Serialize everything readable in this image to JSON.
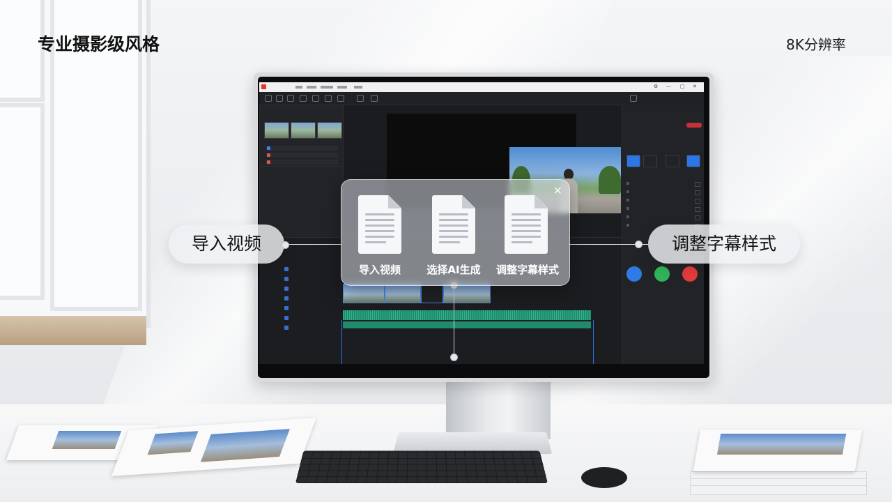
{
  "page": {
    "title": "专业摄影级风格",
    "resolution_badge": "8K分辨率"
  },
  "popup": {
    "items": [
      {
        "label": "导入视频"
      },
      {
        "label": "选择AI生成"
      },
      {
        "label": "调整字幕样式"
      }
    ],
    "close_label": "✕"
  },
  "callouts": {
    "left": "导入视频",
    "right": "调整字幕样式"
  },
  "colors": {
    "accent_blue": "#2d76e6",
    "accent_red": "#c6303a",
    "share_blue": "#2f7be6",
    "share_green": "#2fb45a",
    "share_red": "#e23b3b"
  }
}
